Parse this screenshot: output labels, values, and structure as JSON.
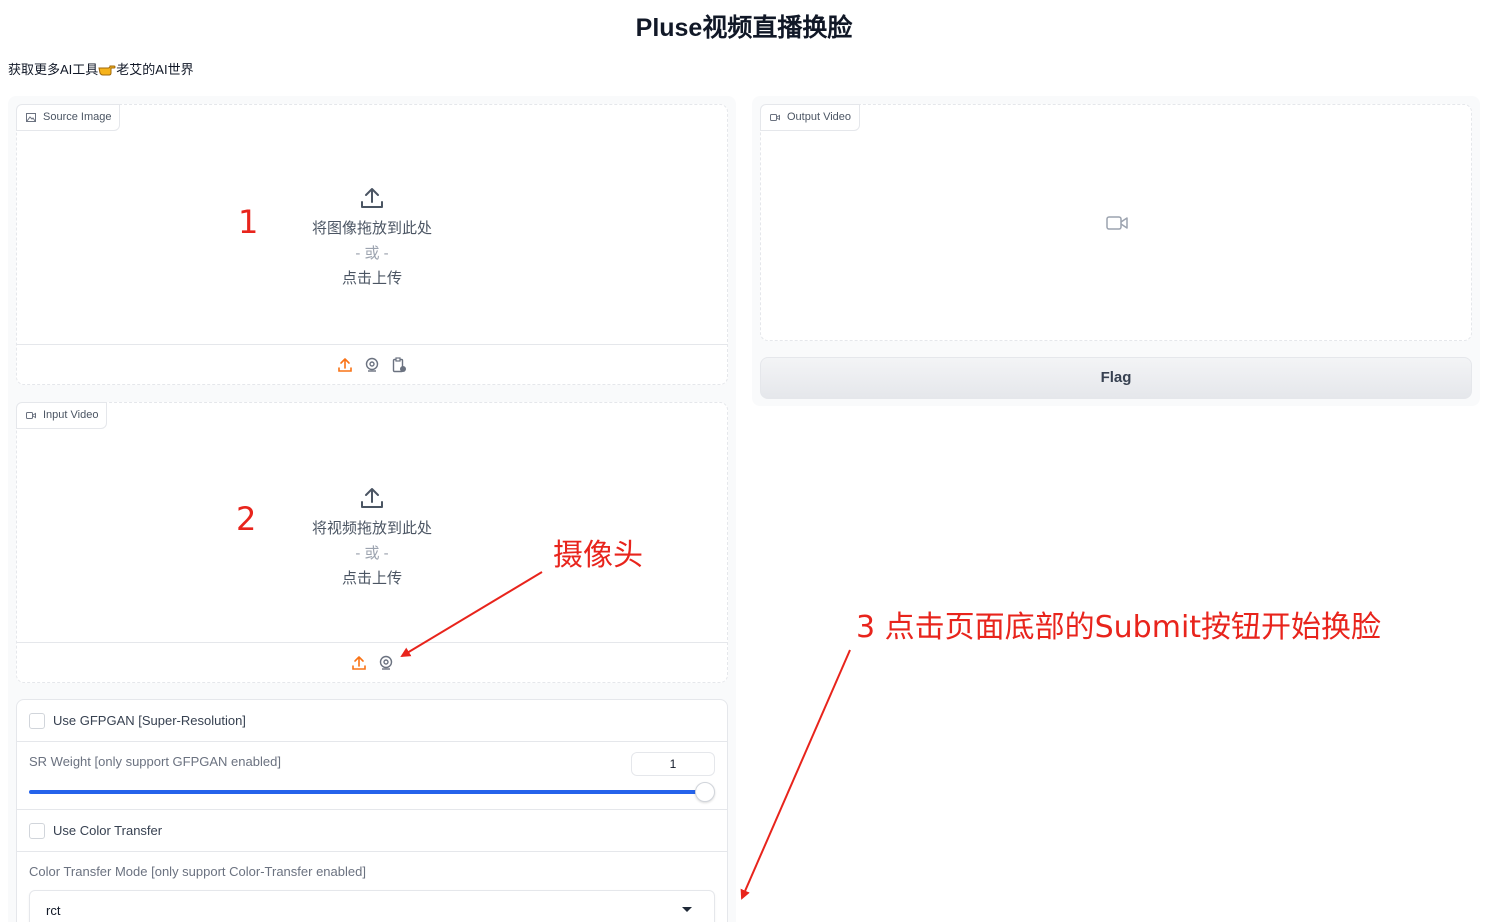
{
  "header": {
    "title": "Pluse视频直播换脸"
  },
  "promo": {
    "text_before": "获取更多AI工具",
    "text_after": "老艾的AI世界"
  },
  "source_image": {
    "label": "Source Image",
    "drop_text": "将图像拖放到此处",
    "or_text": "- 或 -",
    "click_text": "点击上传"
  },
  "input_video": {
    "label": "Input Video",
    "drop_text": "将视频拖放到此处",
    "or_text": "- 或 -",
    "click_text": "点击上传"
  },
  "output_video": {
    "label": "Output Video"
  },
  "flag_button": {
    "label": "Flag"
  },
  "settings": {
    "gfpgan_label": "Use GFPGAN [Super-Resolution]",
    "gfpgan_checked": false,
    "sr_weight_label": "SR Weight [only support GFPGAN enabled]",
    "sr_weight_value": "1",
    "sr_weight_fraction": 1.0,
    "color_transfer_label": "Use Color Transfer",
    "color_transfer_checked": false,
    "color_mode_label": "Color Transfer Mode [only support Color-Transfer enabled]",
    "color_mode_value": "rct"
  },
  "annotations": {
    "step1": "1",
    "step2": "2",
    "camera": "摄像头",
    "step3": "3 点击页面底部的Submit按钮开始换脸"
  },
  "colors": {
    "accent": "#f97316",
    "slider": "#2563eb",
    "annotation": "#e8241c"
  }
}
